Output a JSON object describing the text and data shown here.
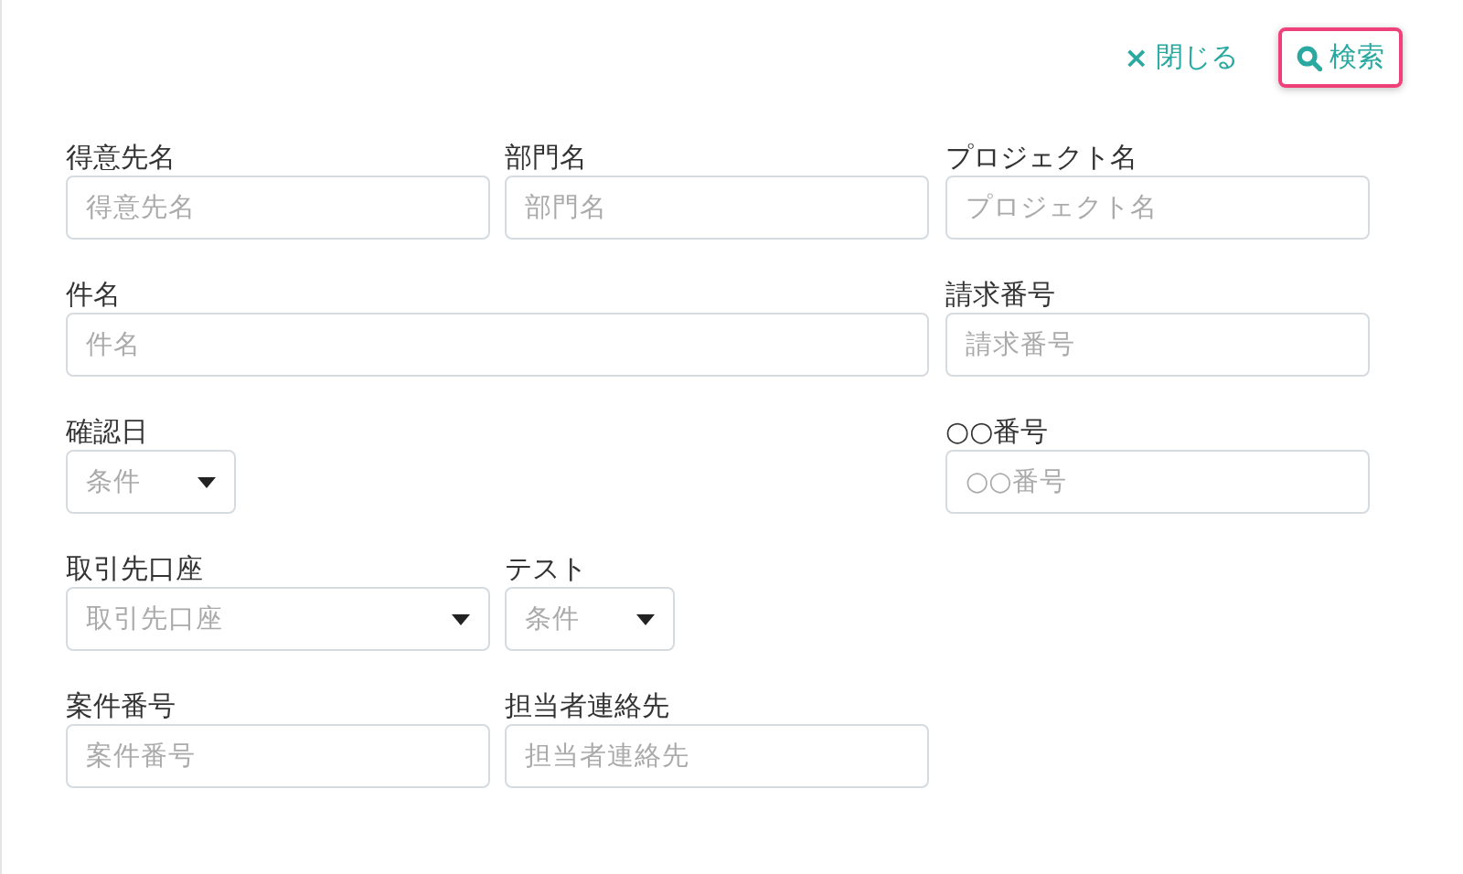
{
  "toolbar": {
    "close": {
      "icon": "×",
      "label": "閉じる"
    },
    "search": {
      "label": "検索",
      "focused": true
    }
  },
  "left_fields": [
    {
      "kind": "text",
      "label": "得意先名",
      "placeholder": "得意先名"
    },
    {
      "kind": "text",
      "label": "部門名",
      "placeholder": "部門名"
    },
    {
      "kind": "wide",
      "label": "件名",
      "placeholder": "件名"
    },
    {
      "kind": "condition",
      "label": "確認日",
      "placeholder": "条件"
    },
    {
      "kind": "select",
      "label": "取引先口座",
      "placeholder": "取引先口座"
    },
    {
      "kind": "condition",
      "label": "テスト",
      "placeholder": "条件"
    },
    {
      "kind": "text",
      "label": "案件番号",
      "placeholder": "案件番号"
    },
    {
      "kind": "text",
      "label": "担当者連絡先",
      "placeholder": "担当者連絡先"
    }
  ],
  "right_fields": [
    {
      "kind": "text",
      "label": "プロジェクト名",
      "placeholder": "プロジェクト名"
    },
    {
      "kind": "text",
      "label": "請求番号",
      "placeholder": "請求番号"
    },
    {
      "kind": "text",
      "label": "○○番号",
      "placeholder": "○○番号"
    }
  ]
}
